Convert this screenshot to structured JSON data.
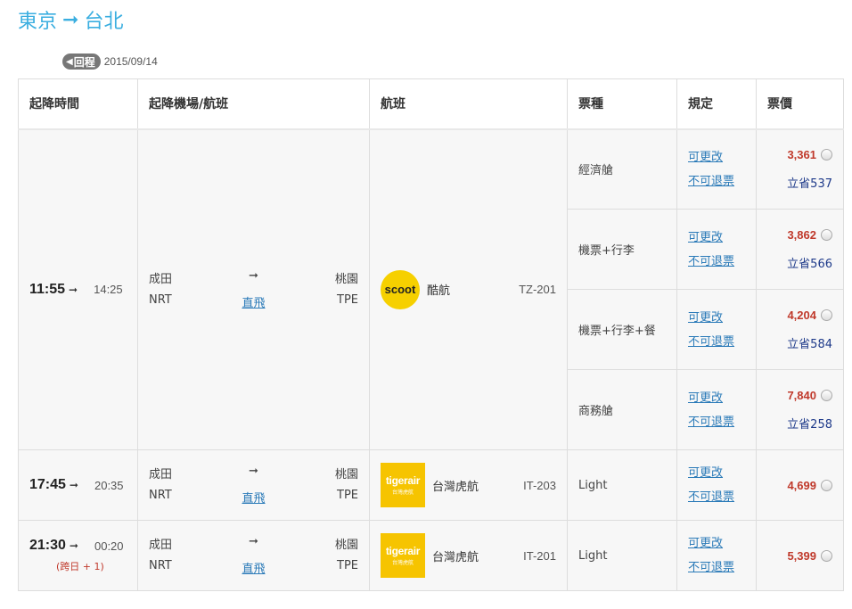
{
  "route": {
    "from": "東京",
    "arrow": "➞",
    "to": "台北"
  },
  "return_info": {
    "badge": "回程",
    "date": "2015/09/14"
  },
  "headers": [
    "起降時間",
    "起降機場/航班",
    "航班",
    "票種",
    "規定",
    "票價"
  ],
  "rule_labels": {
    "change": "可更改",
    "refund": "不可退票"
  },
  "flights": [
    {
      "dep_time": "11:55",
      "arr_time": "14:25",
      "next_day": "",
      "origin_name": "成田",
      "origin_code": "NRT",
      "direct": "直飛",
      "dest_name": "桃園",
      "dest_code": "TPE",
      "airline_logo": "scoot",
      "airline": "酷航",
      "flight_no": "TZ-201",
      "fares": [
        {
          "type": "經濟艙",
          "price": "3,361",
          "save": "立省537"
        },
        {
          "type": "機票+行李",
          "price": "3,862",
          "save": "立省566"
        },
        {
          "type": "機票+行李+餐",
          "price": "4,204",
          "save": "立省584"
        },
        {
          "type": "商務艙",
          "price": "7,840",
          "save": "立省258"
        }
      ]
    },
    {
      "dep_time": "17:45",
      "arr_time": "20:35",
      "next_day": "",
      "origin_name": "成田",
      "origin_code": "NRT",
      "direct": "直飛",
      "dest_name": "桃園",
      "dest_code": "TPE",
      "airline_logo": "tigerair",
      "airline": "台灣虎航",
      "flight_no": "IT-203",
      "fares": [
        {
          "type": "Light",
          "price": "4,699",
          "save": ""
        }
      ]
    },
    {
      "dep_time": "21:30",
      "arr_time": "00:20",
      "next_day": "(跨日 + 1)",
      "origin_name": "成田",
      "origin_code": "NRT",
      "direct": "直飛",
      "dest_name": "桃園",
      "dest_code": "TPE",
      "airline_logo": "tigerair",
      "airline": "台灣虎航",
      "flight_no": "IT-201",
      "fares": [
        {
          "type": "Light",
          "price": "5,399",
          "save": ""
        }
      ]
    }
  ],
  "logos": {
    "scoot": {
      "text": "scoot"
    },
    "tigerair": {
      "text": "tigerair",
      "sub": "台灣虎航"
    }
  },
  "colors": {
    "accent": "#3aaee0",
    "price": "#c0392b",
    "link": "#2a7ab8",
    "save": "#1e3a8a",
    "scoot_yellow": "#f6d000",
    "tiger_yellow": "#f6c400"
  }
}
